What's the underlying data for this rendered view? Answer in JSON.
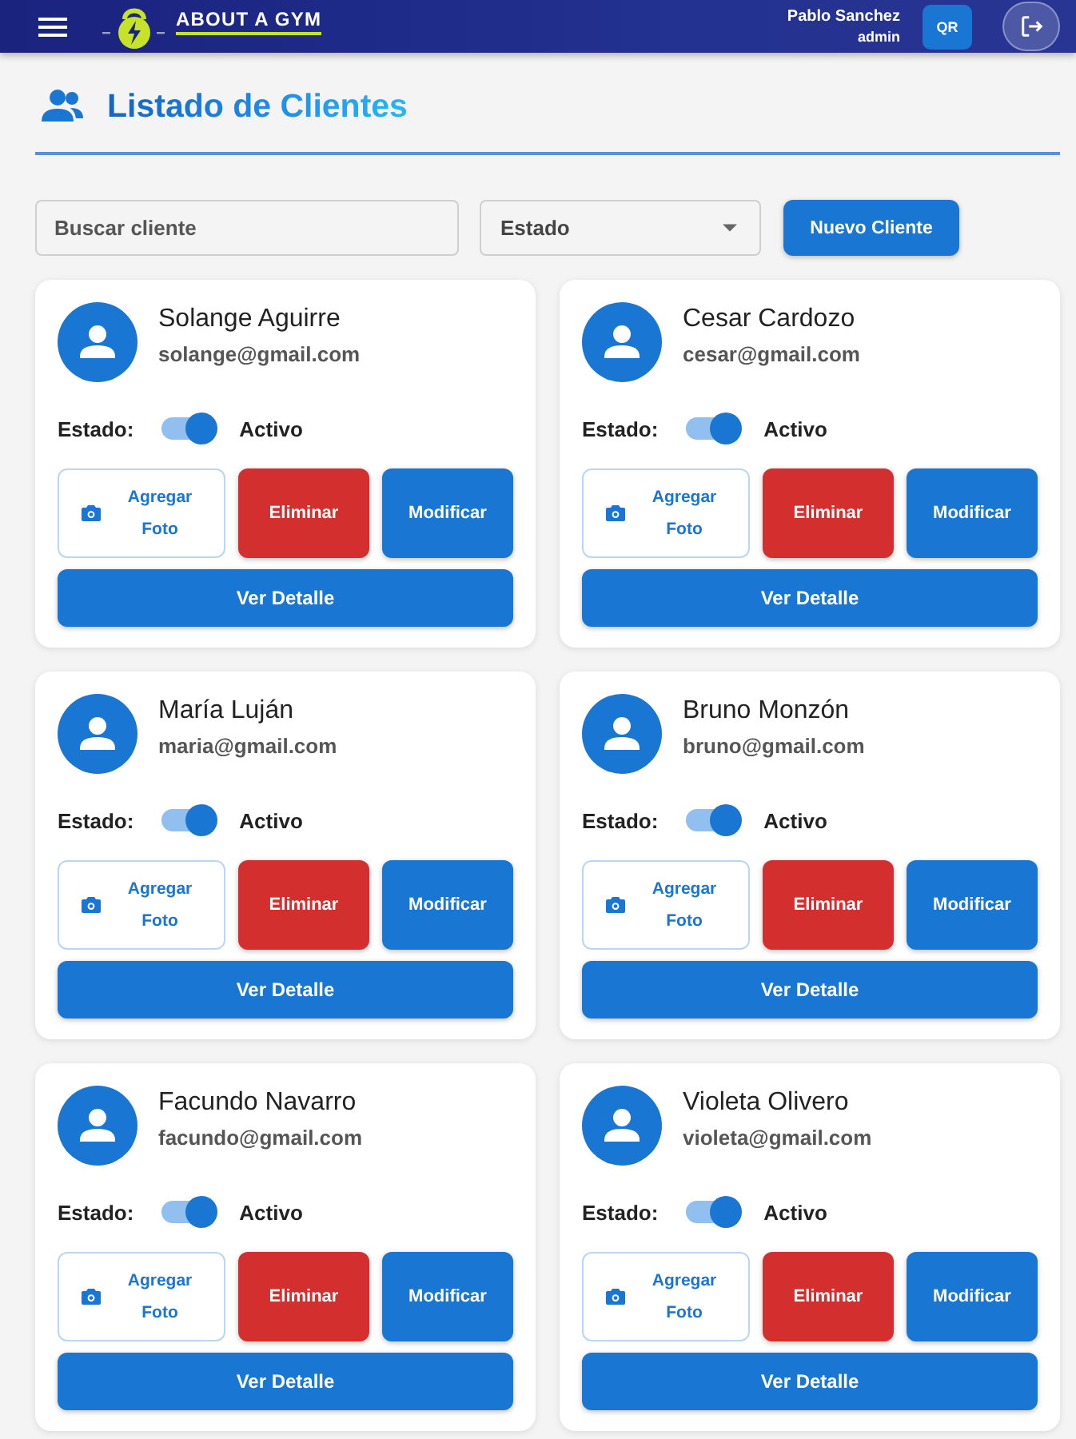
{
  "header": {
    "logo_text": "ABOUT A GYM",
    "user_name": "Pablo Sanchez",
    "user_role": "admin",
    "qr_button": "QR"
  },
  "title": "Listado de Clientes",
  "filters": {
    "search": {
      "placeholder": "Buscar cliente"
    },
    "status_select": {
      "label": "Estado"
    },
    "new_button": "Nuevo Cliente"
  },
  "clients": [
    {
      "name": "Solange Aguirre",
      "email": "solange@gmail.com",
      "status_label": "Estado:",
      "active": true,
      "status_text": "Activo",
      "photo_button": "Agregar Foto",
      "delete_button": "Eliminar",
      "edit_button": "Modificar",
      "detail_button": "Ver Detalle"
    },
    {
      "name": "Cesar Cardozo",
      "email": "cesar@gmail.com",
      "status_label": "Estado:",
      "active": true,
      "status_text": "Activo",
      "photo_button": "Agregar Foto",
      "delete_button": "Eliminar",
      "edit_button": "Modificar",
      "detail_button": "Ver Detalle"
    },
    {
      "name": "María Luján",
      "email": "maria@gmail.com",
      "status_label": "Estado:",
      "active": true,
      "status_text": "Activo",
      "photo_button": "Agregar Foto",
      "delete_button": "Eliminar",
      "edit_button": "Modificar",
      "detail_button": "Ver Detalle"
    },
    {
      "name": "Bruno Monzón",
      "email": "bruno@gmail.com",
      "status_label": "Estado:",
      "active": true,
      "status_text": "Activo",
      "photo_button": "Agregar Foto",
      "delete_button": "Eliminar",
      "edit_button": "Modificar",
      "detail_button": "Ver Detalle"
    },
    {
      "name": "Facundo Navarro",
      "email": "facundo@gmail.com",
      "status_label": "Estado:",
      "active": true,
      "status_text": "Activo",
      "photo_button": "Agregar Foto",
      "delete_button": "Eliminar",
      "edit_button": "Modificar",
      "detail_button": "Ver Detalle"
    },
    {
      "name": "Violeta Olivero",
      "email": "violeta@gmail.com",
      "status_label": "Estado:",
      "active": true,
      "status_text": "Activo",
      "photo_button": "Agregar Foto",
      "delete_button": "Eliminar",
      "edit_button": "Modificar",
      "detail_button": "Ver Detalle"
    }
  ]
}
